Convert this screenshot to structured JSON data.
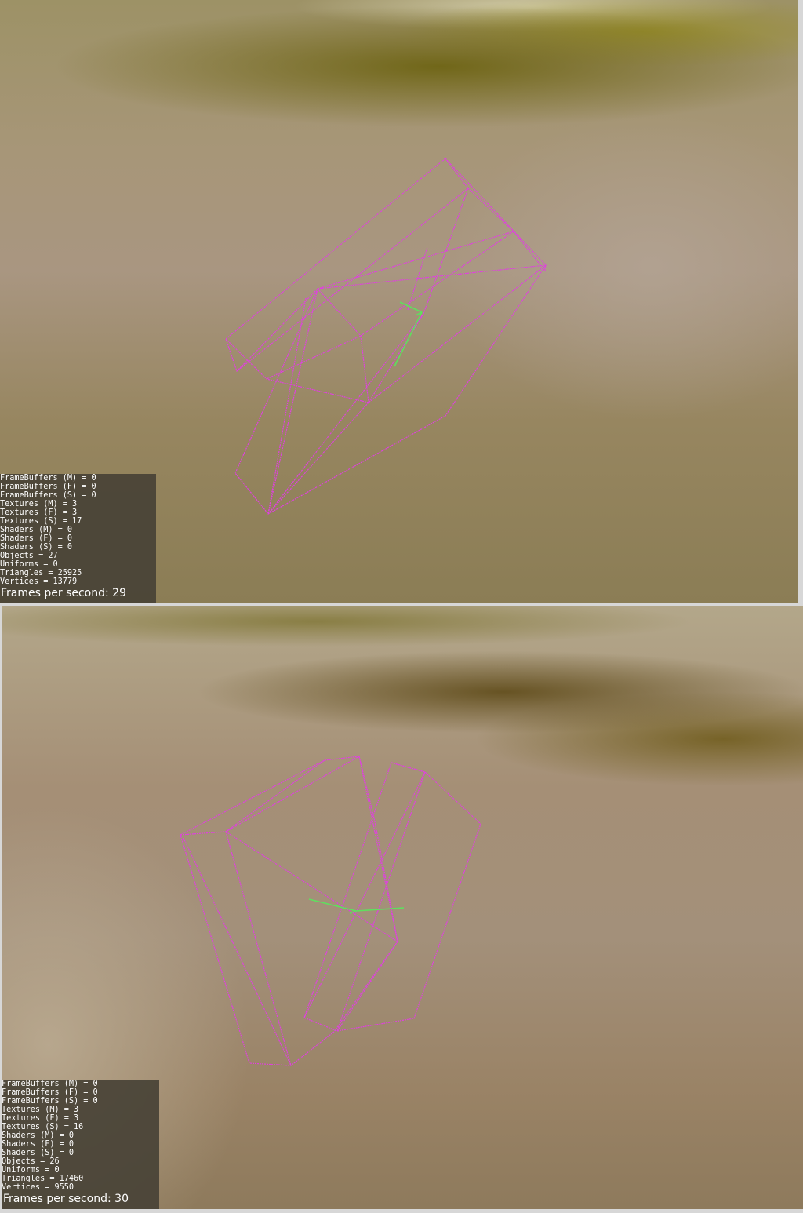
{
  "viewports": [
    {
      "stats": [
        "FrameBuffers (M) = 0",
        "FrameBuffers (F) = 0",
        "FrameBuffers (S) = 0",
        "Textures (M) = 3",
        "Textures (F) = 3",
        "Textures (S) = 17",
        "Shaders (M) = 0",
        "Shaders (F) = 0",
        "Shaders (S) = 0",
        "Objects = 27",
        "Uniforms = 0",
        "Triangles = 25925",
        "Vertices = 13779"
      ],
      "fps_text": "Frames per second: 29"
    },
    {
      "stats": [
        "FrameBuffers (M) = 0",
        "FrameBuffers (F) = 0",
        "FrameBuffers (S) = 0",
        "Textures (M) = 3",
        "Textures (F) = 3",
        "Textures (S) = 16",
        "Shaders (M) = 0",
        "Shaders (F) = 0",
        "Shaders (S) = 0",
        "Objects = 26",
        "Uniforms = 0",
        "Triangles = 17460",
        "Vertices = 9550"
      ],
      "fps_text": "Frames per second: 30"
    }
  ],
  "colors": {
    "wireframe": "#e040e0",
    "axis": "#5ee05e",
    "overlay_bg": "#484236"
  }
}
